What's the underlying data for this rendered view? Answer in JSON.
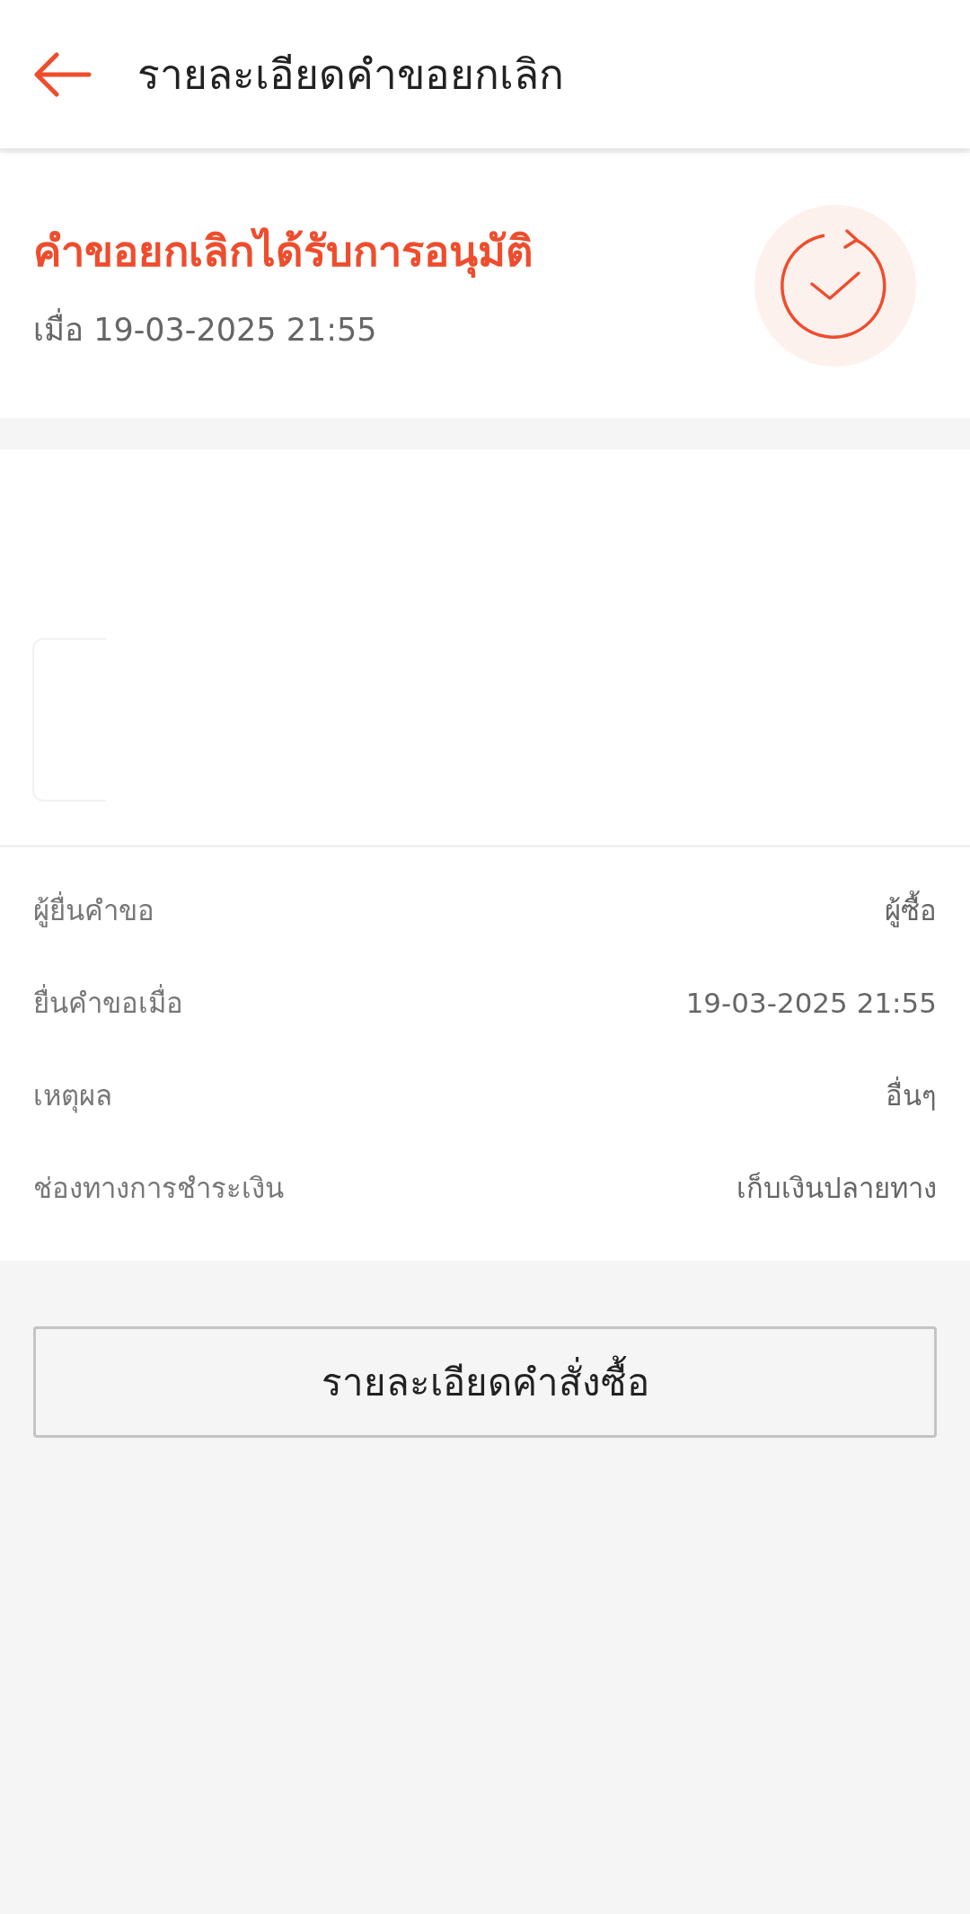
{
  "header": {
    "title": "รายละเอียดคำขอยกเลิก"
  },
  "status": {
    "title": "คำขอยกเลิกได้รับการอนุมัติ",
    "time": "เมื่อ 19-03-2025 21:55"
  },
  "details": [
    {
      "label": "ผู้ยื่นคำขอ",
      "value": "ผู้ซื้อ"
    },
    {
      "label": "ยื่นคำขอเมื่อ",
      "value": "19-03-2025 21:55"
    },
    {
      "label": "เหตุผล",
      "value": "อื่นๆ"
    },
    {
      "label": "ช่องทางการชำระเงิน",
      "value": "เก็บเงินปลายทาง"
    }
  ],
  "button": {
    "label": "รายละเอียดคำสั่งซื้อ"
  }
}
